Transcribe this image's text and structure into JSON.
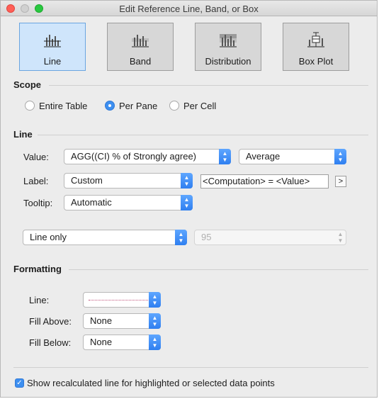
{
  "window": {
    "title": "Edit Reference Line, Band, or Box"
  },
  "types": [
    {
      "label": "Line",
      "icon": "line-chart-icon",
      "selected": true
    },
    {
      "label": "Band",
      "icon": "band-chart-icon",
      "selected": false
    },
    {
      "label": "Distribution",
      "icon": "distribution-chart-icon",
      "selected": false
    },
    {
      "label": "Box Plot",
      "icon": "box-plot-icon",
      "selected": false
    }
  ],
  "scope": {
    "heading": "Scope",
    "options": [
      "Entire Table",
      "Per Pane",
      "Per Cell"
    ],
    "selected": "Per Pane"
  },
  "line_section": {
    "heading": "Line",
    "value_label": "Value:",
    "value_field": "AGG((CI) % of Strongly agree)",
    "aggregation": "Average",
    "label_label": "Label:",
    "label_mode": "Custom",
    "label_text": "<Computation> = <Value>",
    "insert_button": ">",
    "tooltip_label": "Tooltip:",
    "tooltip_mode": "Automatic",
    "line_mode": "Line only",
    "confidence": "95"
  },
  "formatting": {
    "heading": "Formatting",
    "line_label": "Line:",
    "fill_above_label": "Fill Above:",
    "fill_above": "None",
    "fill_below_label": "Fill Below:",
    "fill_below": "None"
  },
  "recalc": {
    "label": "Show recalculated line for highlighted or selected data points",
    "checked": true
  },
  "colors": {
    "accent": "#3d8ff0",
    "selected_bg": "#cfe5fb",
    "line_color": "#c0527a"
  }
}
